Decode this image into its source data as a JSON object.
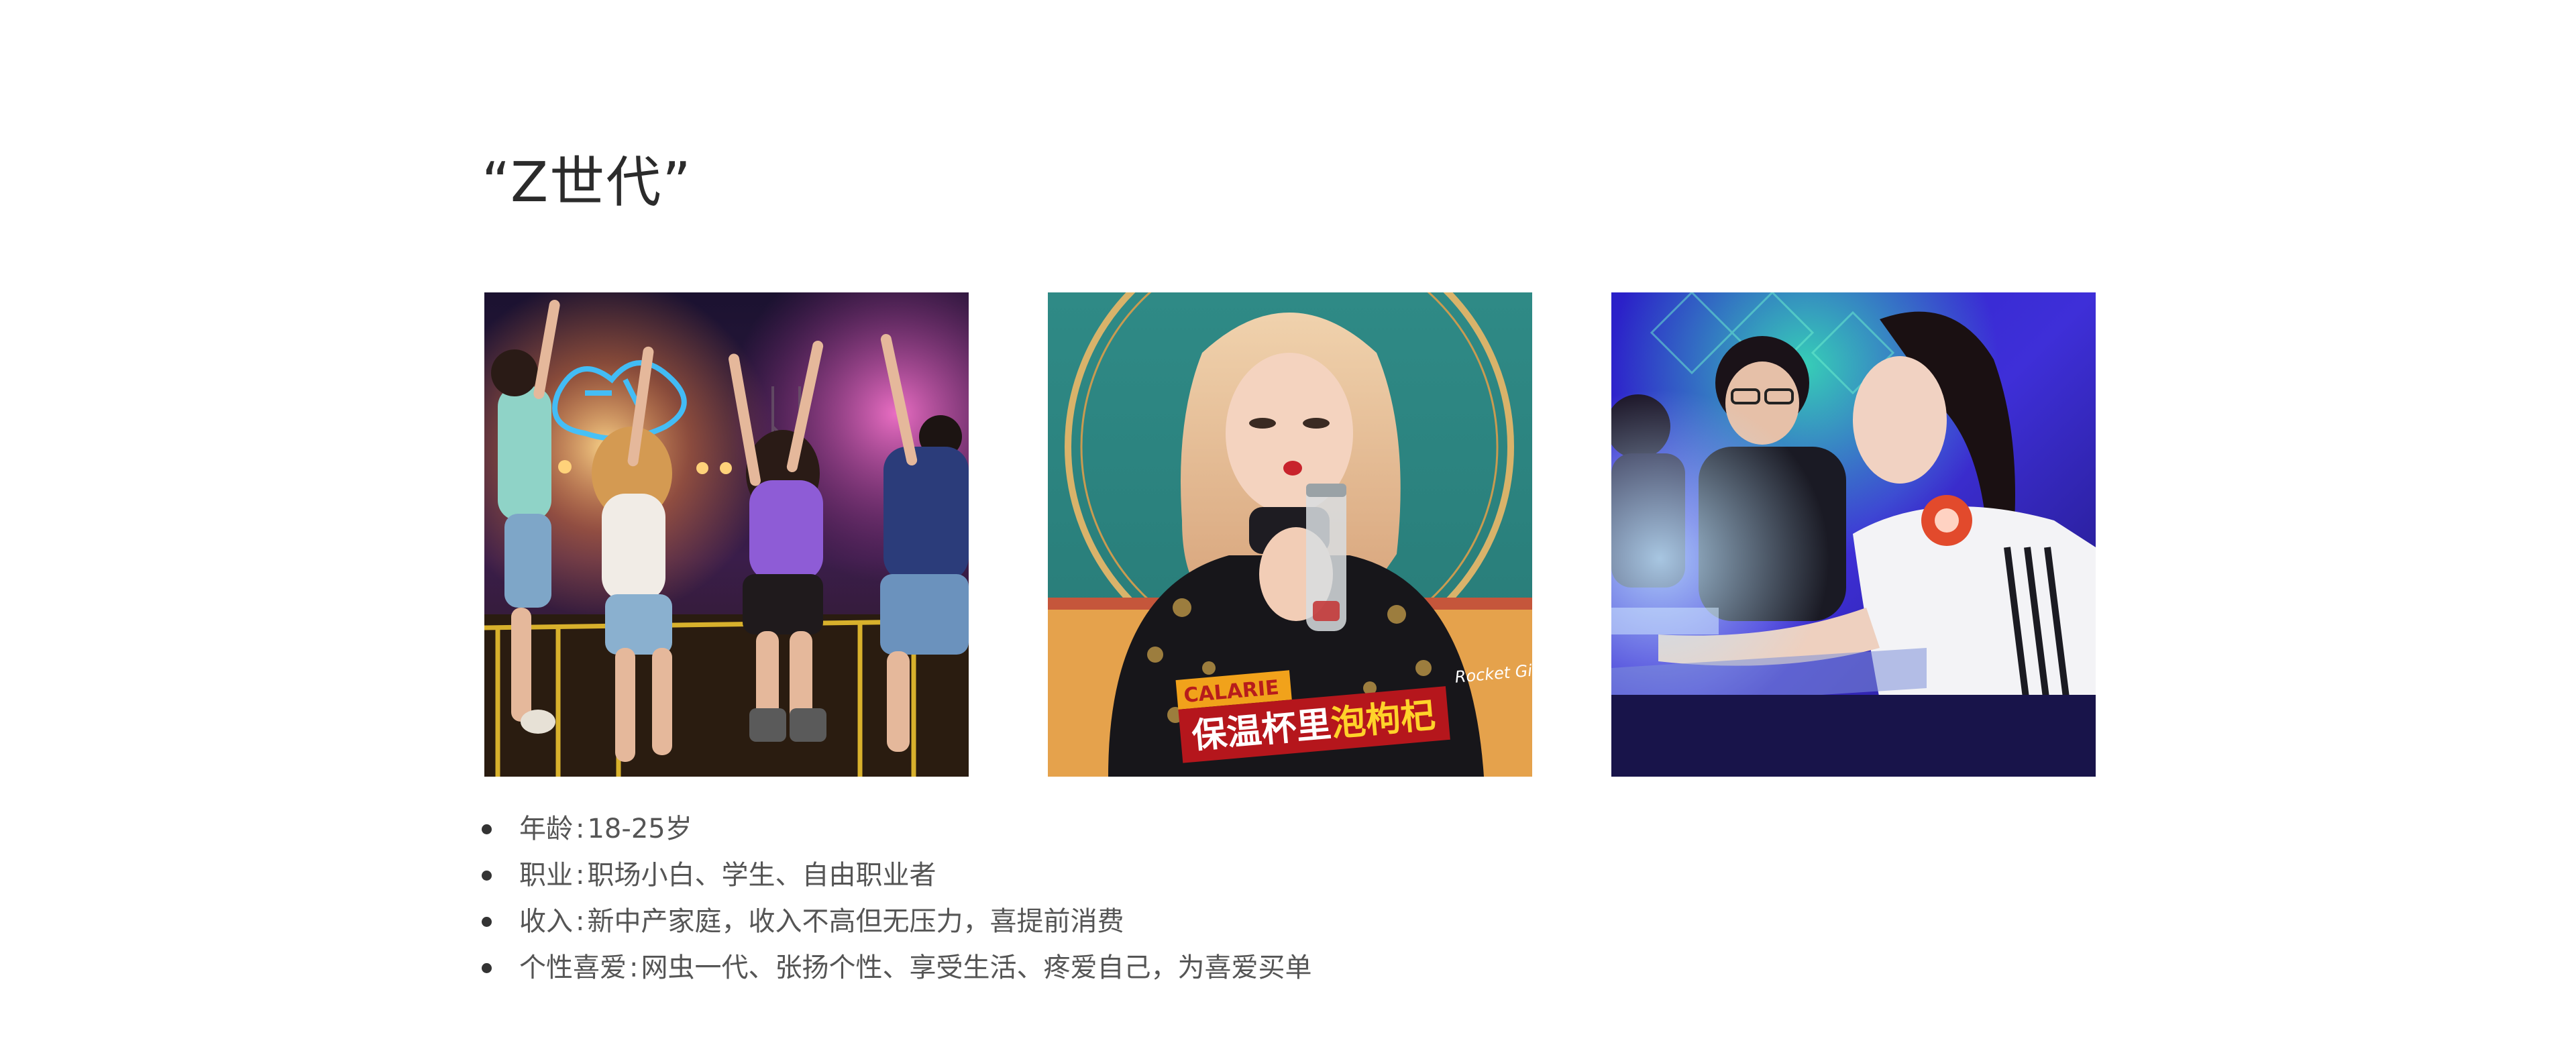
{
  "section": {
    "title": "“Z世代”"
  },
  "photos": [
    {
      "alt": "concert crowd jumping"
    },
    {
      "alt": "woman drinking from bottle",
      "caption_tag": "CALARIE",
      "caption_main_a": "保温杯里",
      "caption_main_b": "泡枸杞",
      "caption_side": "Rocket Girl"
    },
    {
      "alt": "gamers at computers"
    }
  ],
  "traits": [
    {
      "label": "年龄",
      "sep": ":",
      "value": "18-25岁"
    },
    {
      "label": "职业",
      "sep": ":",
      "value": "职场小白、学生、自由职业者"
    },
    {
      "label": "收入",
      "sep": ":",
      "value": "新中产家庭，收入不高但无压力，喜提前消费"
    },
    {
      "label": "个性喜爱",
      "sep": ":",
      "value": "网虫一代、张扬个性、享受生活、疼爱自己，为喜爱买单"
    }
  ],
  "colors": {
    "title": "#2b2b2b",
    "text": "#555555",
    "bullet": "#333333",
    "background": "#ffffff"
  }
}
